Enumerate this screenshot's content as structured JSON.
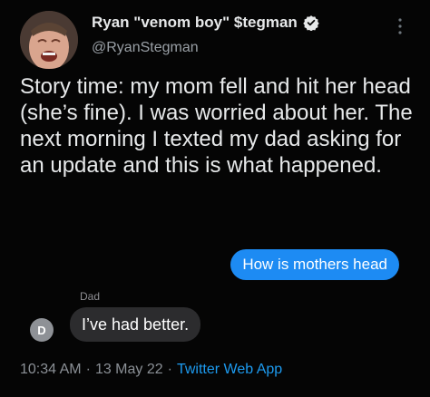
{
  "author": {
    "display_name": "Ryan \"venom boy\" $tegman",
    "handle": "@RyanStegman",
    "verified": true
  },
  "tweet": {
    "text": "Story time: my mom fell and hit her head (she’s fine). I was worried about her. The next morning I texted my dad asking for an update and this is what happened."
  },
  "screenshot": {
    "sent_message": "How is mothers head",
    "sender_label": "Dad",
    "contact_initial": "D",
    "received_message": "I’ve had better."
  },
  "meta": {
    "time": "10:34 AM",
    "separator": "·",
    "date": "13 May 22",
    "source": "Twitter Web App"
  },
  "colors": {
    "background": "#050505",
    "accent": "#1d9bf0",
    "imessage_blue": "#1d8bf3",
    "received_bubble": "#2c2c2e"
  },
  "icons": [
    "verified-badge-icon",
    "more-options-icon"
  ]
}
